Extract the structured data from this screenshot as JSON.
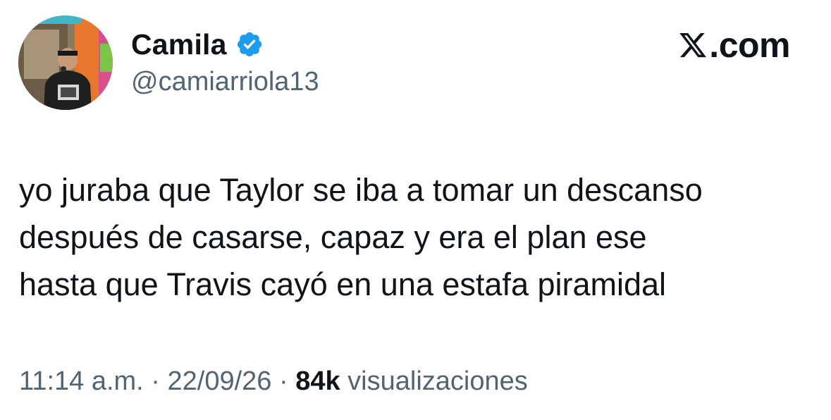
{
  "author": {
    "display_name": "Camila",
    "handle": "@camiarriola13",
    "verified": true,
    "verified_color": "#1d9bf0"
  },
  "site": {
    "domain": ".com",
    "icon": "x-logo-icon"
  },
  "tweet": {
    "lines": [
      "yo juraba que Taylor se iba a tomar un descanso",
      "después de casarse, capaz y era el plan ese",
      "hasta que Travis cayó en una estafa piramidal"
    ]
  },
  "meta": {
    "time": "11:14 a.m.",
    "separator": " · ",
    "date": "22/09/26",
    "views_count": "84k",
    "views_label": " visualizaciones"
  }
}
